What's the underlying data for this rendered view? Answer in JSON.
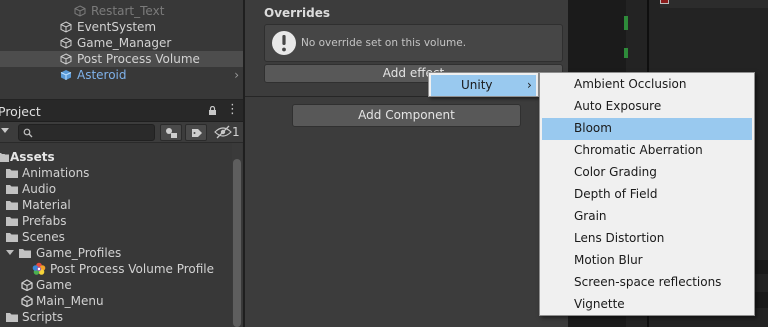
{
  "hierarchy": {
    "items": [
      {
        "label": "Restart_Text"
      },
      {
        "label": "EventSystem"
      },
      {
        "label": "Game_Manager"
      },
      {
        "label": "Post Process Volume"
      },
      {
        "label": "Asteroid"
      }
    ]
  },
  "project": {
    "tab_title": "Project",
    "search_placeholder": "",
    "hidden_count": "1",
    "tree": [
      {
        "label": "Assets"
      },
      {
        "label": "Animations"
      },
      {
        "label": "Audio"
      },
      {
        "label": "Material"
      },
      {
        "label": "Prefabs"
      },
      {
        "label": "Scenes"
      },
      {
        "label": "Game_Profiles"
      },
      {
        "label": "Post Process Volume Profile"
      },
      {
        "label": "Game"
      },
      {
        "label": "Main_Menu"
      },
      {
        "label": "Scripts"
      }
    ]
  },
  "inspector": {
    "overrides_title": "Overrides",
    "no_override_msg": "No override set on this volume.",
    "add_effect_label": "Add effect",
    "add_component_label": "Add Component"
  },
  "menus": {
    "unity_label": "Unity",
    "effects": [
      {
        "label": "Ambient Occlusion"
      },
      {
        "label": "Auto Exposure"
      },
      {
        "label": "Bloom",
        "highlighted": true
      },
      {
        "label": "Chromatic Aberration"
      },
      {
        "label": "Color Grading"
      },
      {
        "label": "Depth of Field"
      },
      {
        "label": "Grain"
      },
      {
        "label": "Lens Distortion"
      },
      {
        "label": "Motion Blur"
      },
      {
        "label": "Screen-space reflections"
      },
      {
        "label": "Vignette"
      }
    ]
  },
  "colors": {
    "panel_bg": "#383838",
    "inspector_bg": "#3c3c3c",
    "selection_blue": "#99c9ef",
    "prefab_blue": "#7fb2ea",
    "folder": "#c2c2c2"
  }
}
